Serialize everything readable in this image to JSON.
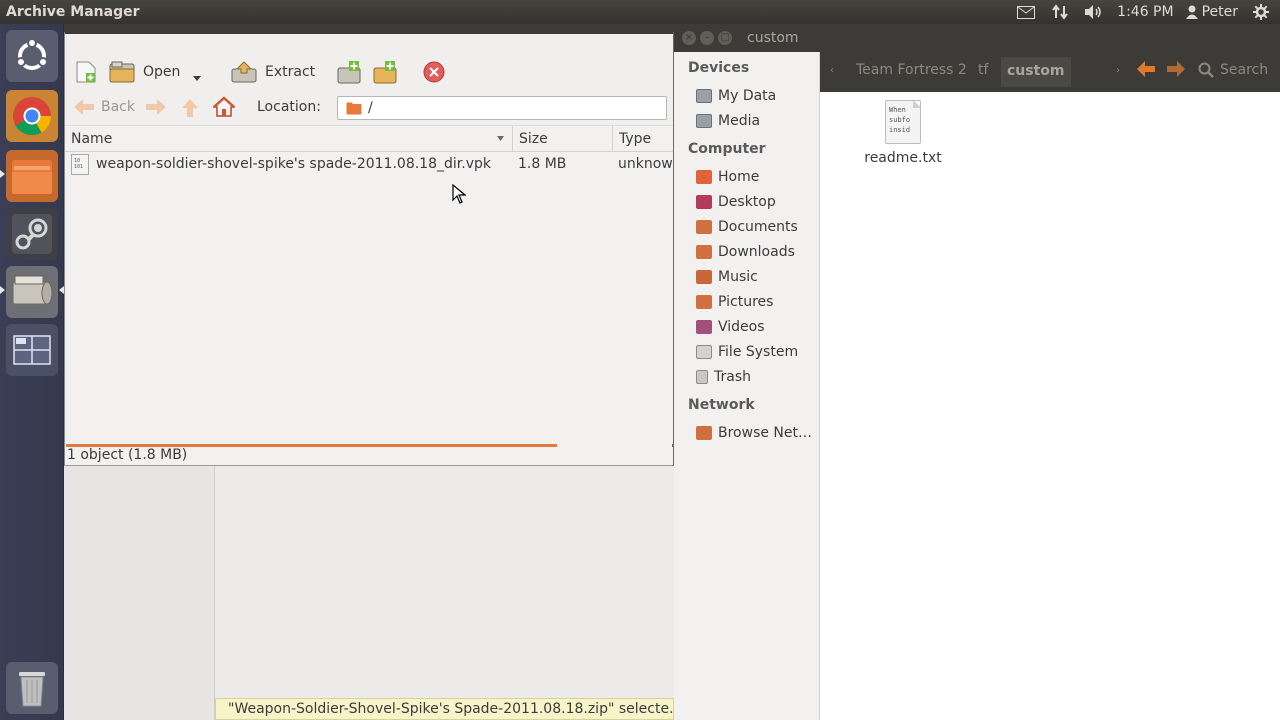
{
  "top_panel": {
    "app_title": "Archive Manager",
    "clock": "1:46 PM",
    "user": "Peter",
    "icons": [
      "mail-icon",
      "network-arrows-icon",
      "volume-icon",
      "user-icon",
      "gear-icon"
    ]
  },
  "launcher": {
    "items": [
      "ubuntu-dash-icon",
      "chrome-icon",
      "files-icon",
      "steam-icon",
      "archive-manager-icon",
      "workspace-switcher-icon",
      "trash-icon"
    ]
  },
  "archive_manager": {
    "toolbar": {
      "open_label": "Open",
      "extract_label": "Extract"
    },
    "nav": {
      "back_label": "Back",
      "location_label": "Location:",
      "location_value": "/"
    },
    "columns": {
      "name": "Name",
      "size": "Size",
      "type": "Type"
    },
    "files": [
      {
        "name": "weapon-soldier-shovel-spike's spade-2011.08.18_dir.vpk",
        "size": "1.8 MB",
        "type": "unknown"
      }
    ],
    "status": "1 object (1.8 MB)",
    "progress_fraction": 0.81
  },
  "background_window": {
    "status_tip": "\"Weapon-Soldier-Shovel-Spike's Spade-2011.08.18.zip\" selecte…"
  },
  "file_manager": {
    "window_title": "custom",
    "sidebar": {
      "devices_header": "Devices",
      "devices": [
        "My Data",
        "Media"
      ],
      "computer_header": "Computer",
      "computer": [
        "Home",
        "Desktop",
        "Documents",
        "Downloads",
        "Music",
        "Pictures",
        "Videos",
        "File System",
        "Trash"
      ],
      "network_header": "Network",
      "network": [
        "Browse Net…"
      ]
    },
    "breadcrumbs": [
      "Team Fortress 2",
      "tf",
      "custom"
    ],
    "search_label": "Search",
    "files": [
      {
        "name": "readme.txt",
        "preview": [
          "When",
          "subfo",
          "insid"
        ]
      }
    ],
    "colors": {
      "home": "#e0633a",
      "desktop": "#b23a5a",
      "folder": "#d07040"
    }
  }
}
